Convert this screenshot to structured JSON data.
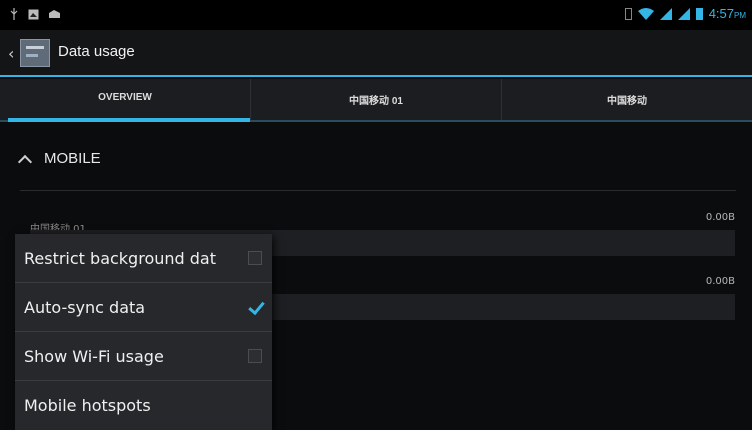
{
  "statusbar": {
    "time": "4:57",
    "ampm": "PM",
    "icons": [
      "usb-icon",
      "screenshot-icon",
      "notification-icon",
      "sim-icon",
      "wifi-icon",
      "signal-icon",
      "signal-icon",
      "battery-icon"
    ]
  },
  "actionbar": {
    "title": "Data usage"
  },
  "tabs": [
    {
      "label": "OVERVIEW",
      "active": true
    },
    {
      "label": "中国移动 01",
      "active": false
    },
    {
      "label": "中国移动",
      "active": false
    }
  ],
  "section": {
    "title": "MOBILE"
  },
  "usage": [
    {
      "label": "中国移动 01",
      "value": "0.00B"
    },
    {
      "label": "",
      "value": "0.00B"
    }
  ],
  "menu": {
    "items": [
      {
        "label": "Restrict background dat",
        "checkbox": true,
        "checked": false
      },
      {
        "label": "Auto-sync data",
        "checkbox": true,
        "checked": true
      },
      {
        "label": "Show Wi-Fi usage",
        "checkbox": true,
        "checked": false
      },
      {
        "label": "Mobile hotspots",
        "checkbox": false,
        "checked": false
      }
    ]
  },
  "colors": {
    "accent": "#33b5e5",
    "background": "#0b0c0e"
  }
}
